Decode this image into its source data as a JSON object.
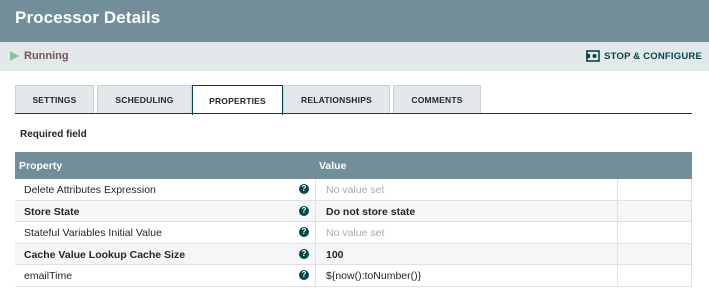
{
  "window": {
    "title": "Processor Details"
  },
  "status": {
    "label": "Running",
    "icon": "play-icon",
    "color": "#7dc7a0"
  },
  "actions": {
    "stop_configure": "STOP & CONFIGURE"
  },
  "tabs": [
    {
      "label": "SETTINGS",
      "active": false
    },
    {
      "label": "SCHEDULING",
      "active": false
    },
    {
      "label": "PROPERTIES",
      "active": true
    },
    {
      "label": "RELATIONSHIPS",
      "active": false
    },
    {
      "label": "COMMENTS",
      "active": false
    }
  ],
  "properties": {
    "required_label": "Required field",
    "columns": {
      "property": "Property",
      "value": "Value"
    },
    "rows": [
      {
        "name": "Delete Attributes Expression",
        "required": false,
        "value": "No value set",
        "unset": true
      },
      {
        "name": "Store State",
        "required": true,
        "value": "Do not store state",
        "unset": false
      },
      {
        "name": "Stateful Variables Initial Value",
        "required": false,
        "value": "No value set",
        "unset": true
      },
      {
        "name": "Cache Value Lookup Cache Size",
        "required": true,
        "value": "100",
        "unset": false
      },
      {
        "name": "emailTime",
        "required": false,
        "value": "${now():toNumber()}",
        "unset": false
      }
    ]
  },
  "colors": {
    "header": "#728e9b",
    "accent": "#004849",
    "status_text": "#775351"
  }
}
